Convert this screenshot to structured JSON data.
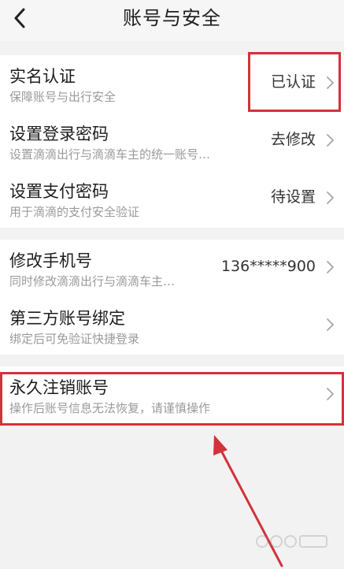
{
  "header": {
    "title": "账号与安全",
    "back_icon": "chevron-left-icon"
  },
  "rows": [
    {
      "title": "实名认证",
      "subtitle": "保障账号与出行安全",
      "value": "已认证"
    },
    {
      "title": "设置登录密码",
      "subtitle": "设置滴滴出行与滴滴车主的统一账号…",
      "value": "去修改"
    },
    {
      "title": "设置支付密码",
      "subtitle": "用于滴滴的支付安全验证",
      "value": "待设置"
    },
    {
      "title": "修改手机号",
      "subtitle": "同时修改滴滴出行与滴滴车主…",
      "value": "136*****900"
    },
    {
      "title": "第三方账号绑定",
      "subtitle": "绑定后可免验证快捷登录",
      "value": ""
    },
    {
      "title": "永久注销账号",
      "subtitle": "操作后账号信息无法恢复，请谨慎操作",
      "value": ""
    }
  ],
  "colors": {
    "annotation": "#d2323a",
    "background": "#f2f2f2"
  }
}
